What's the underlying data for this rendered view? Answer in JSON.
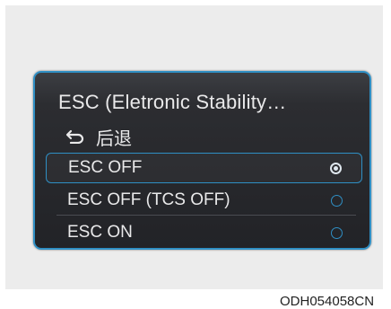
{
  "menu": {
    "title": "ESC (Eletronic Stability…",
    "back_label": "后退",
    "options": [
      {
        "label": "ESC OFF",
        "selected": true
      },
      {
        "label": "ESC OFF (TCS OFF)",
        "selected": false
      },
      {
        "label": "ESC ON",
        "selected": false
      }
    ]
  },
  "image_code": "ODH054058CN",
  "colors": {
    "accent": "#2f8fc4",
    "panel_background": "#26272b",
    "text": "#e9e9ea"
  },
  "icons": {
    "back": "back-arrow-icon",
    "radio_selected": "radio-selected-icon",
    "radio_unselected": "radio-unselected-icon"
  }
}
